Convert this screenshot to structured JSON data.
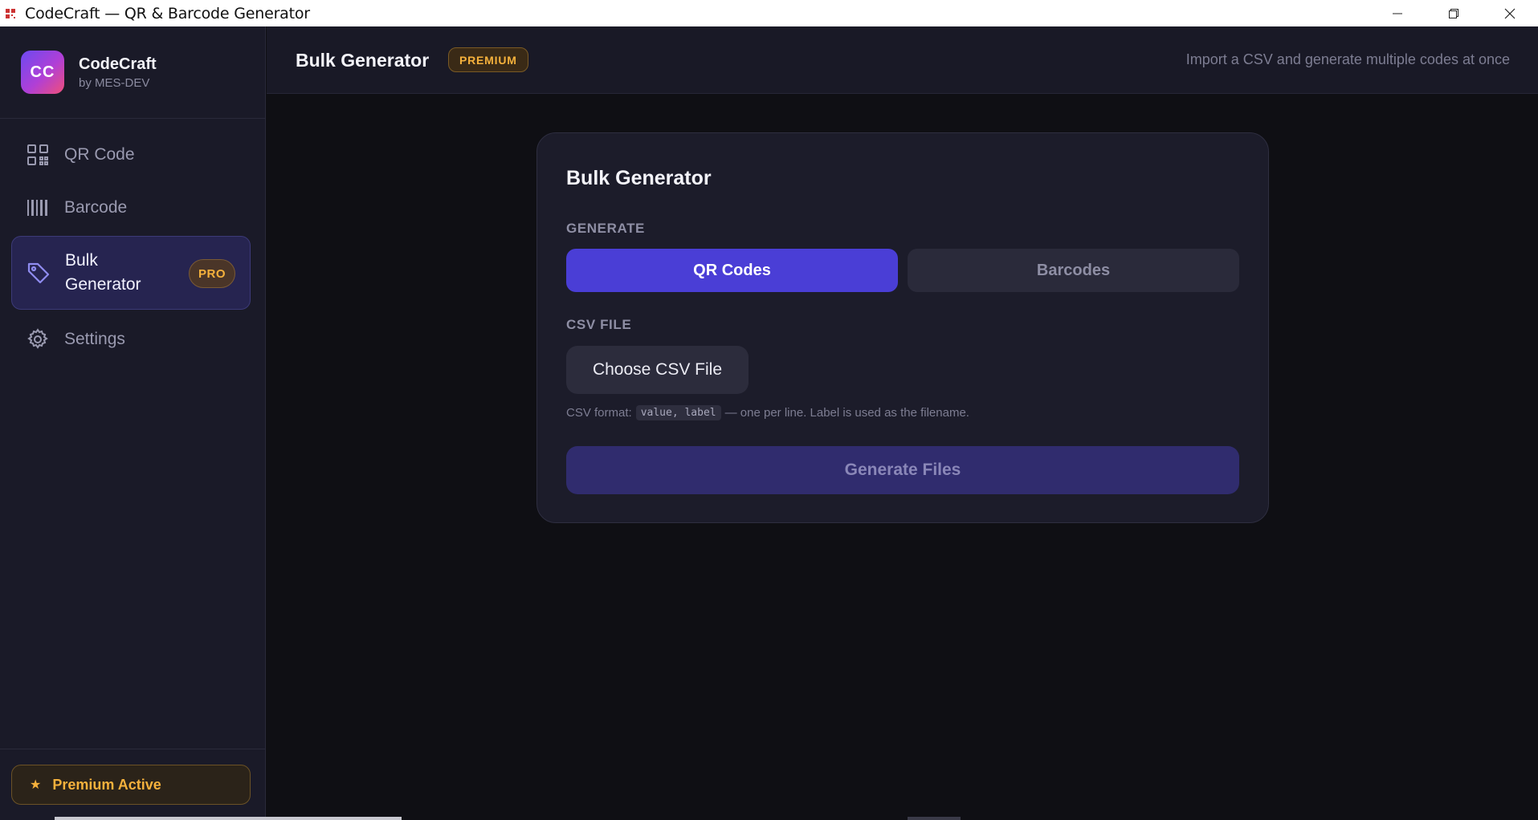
{
  "window": {
    "title": "CodeCraft — QR & Barcode Generator",
    "controls": [
      "minimize-icon",
      "restore-icon",
      "close-icon"
    ]
  },
  "brand": {
    "logo_text": "CC",
    "name": "CodeCraft",
    "by": "by MES-DEV"
  },
  "sidebar": {
    "items": [
      {
        "label": "QR Code",
        "icon": "qr-icon",
        "active": false
      },
      {
        "label": "Barcode",
        "icon": "barcode-icon",
        "active": false
      },
      {
        "label": "Bulk Generator",
        "icon": "tag-icon",
        "active": true,
        "badge": "PRO"
      },
      {
        "label": "Settings",
        "icon": "gear-icon",
        "active": false
      }
    ],
    "footer": {
      "icon": "star-icon",
      "label": "Premium Active"
    }
  },
  "header": {
    "title": "Bulk Generator",
    "badge": "PREMIUM",
    "subtitle": "Import a CSV and generate multiple codes at once"
  },
  "card": {
    "title": "Bulk Generator",
    "generate_label": "GENERATE",
    "options": [
      {
        "label": "QR Codes",
        "selected": true
      },
      {
        "label": "Barcodes",
        "selected": false
      }
    ],
    "csv_label": "CSV FILE",
    "choose_button": "Choose CSV File",
    "hint_prefix": "CSV format:",
    "hint_code": "value, label",
    "hint_suffix": "— one per line. Label is used as the filename.",
    "generate_button": "Generate Files"
  },
  "colors": {
    "accent": "#4a3ed6",
    "premium": "#f5b13c",
    "background": "#0f0f14",
    "sidebar": "#1a1a28"
  }
}
